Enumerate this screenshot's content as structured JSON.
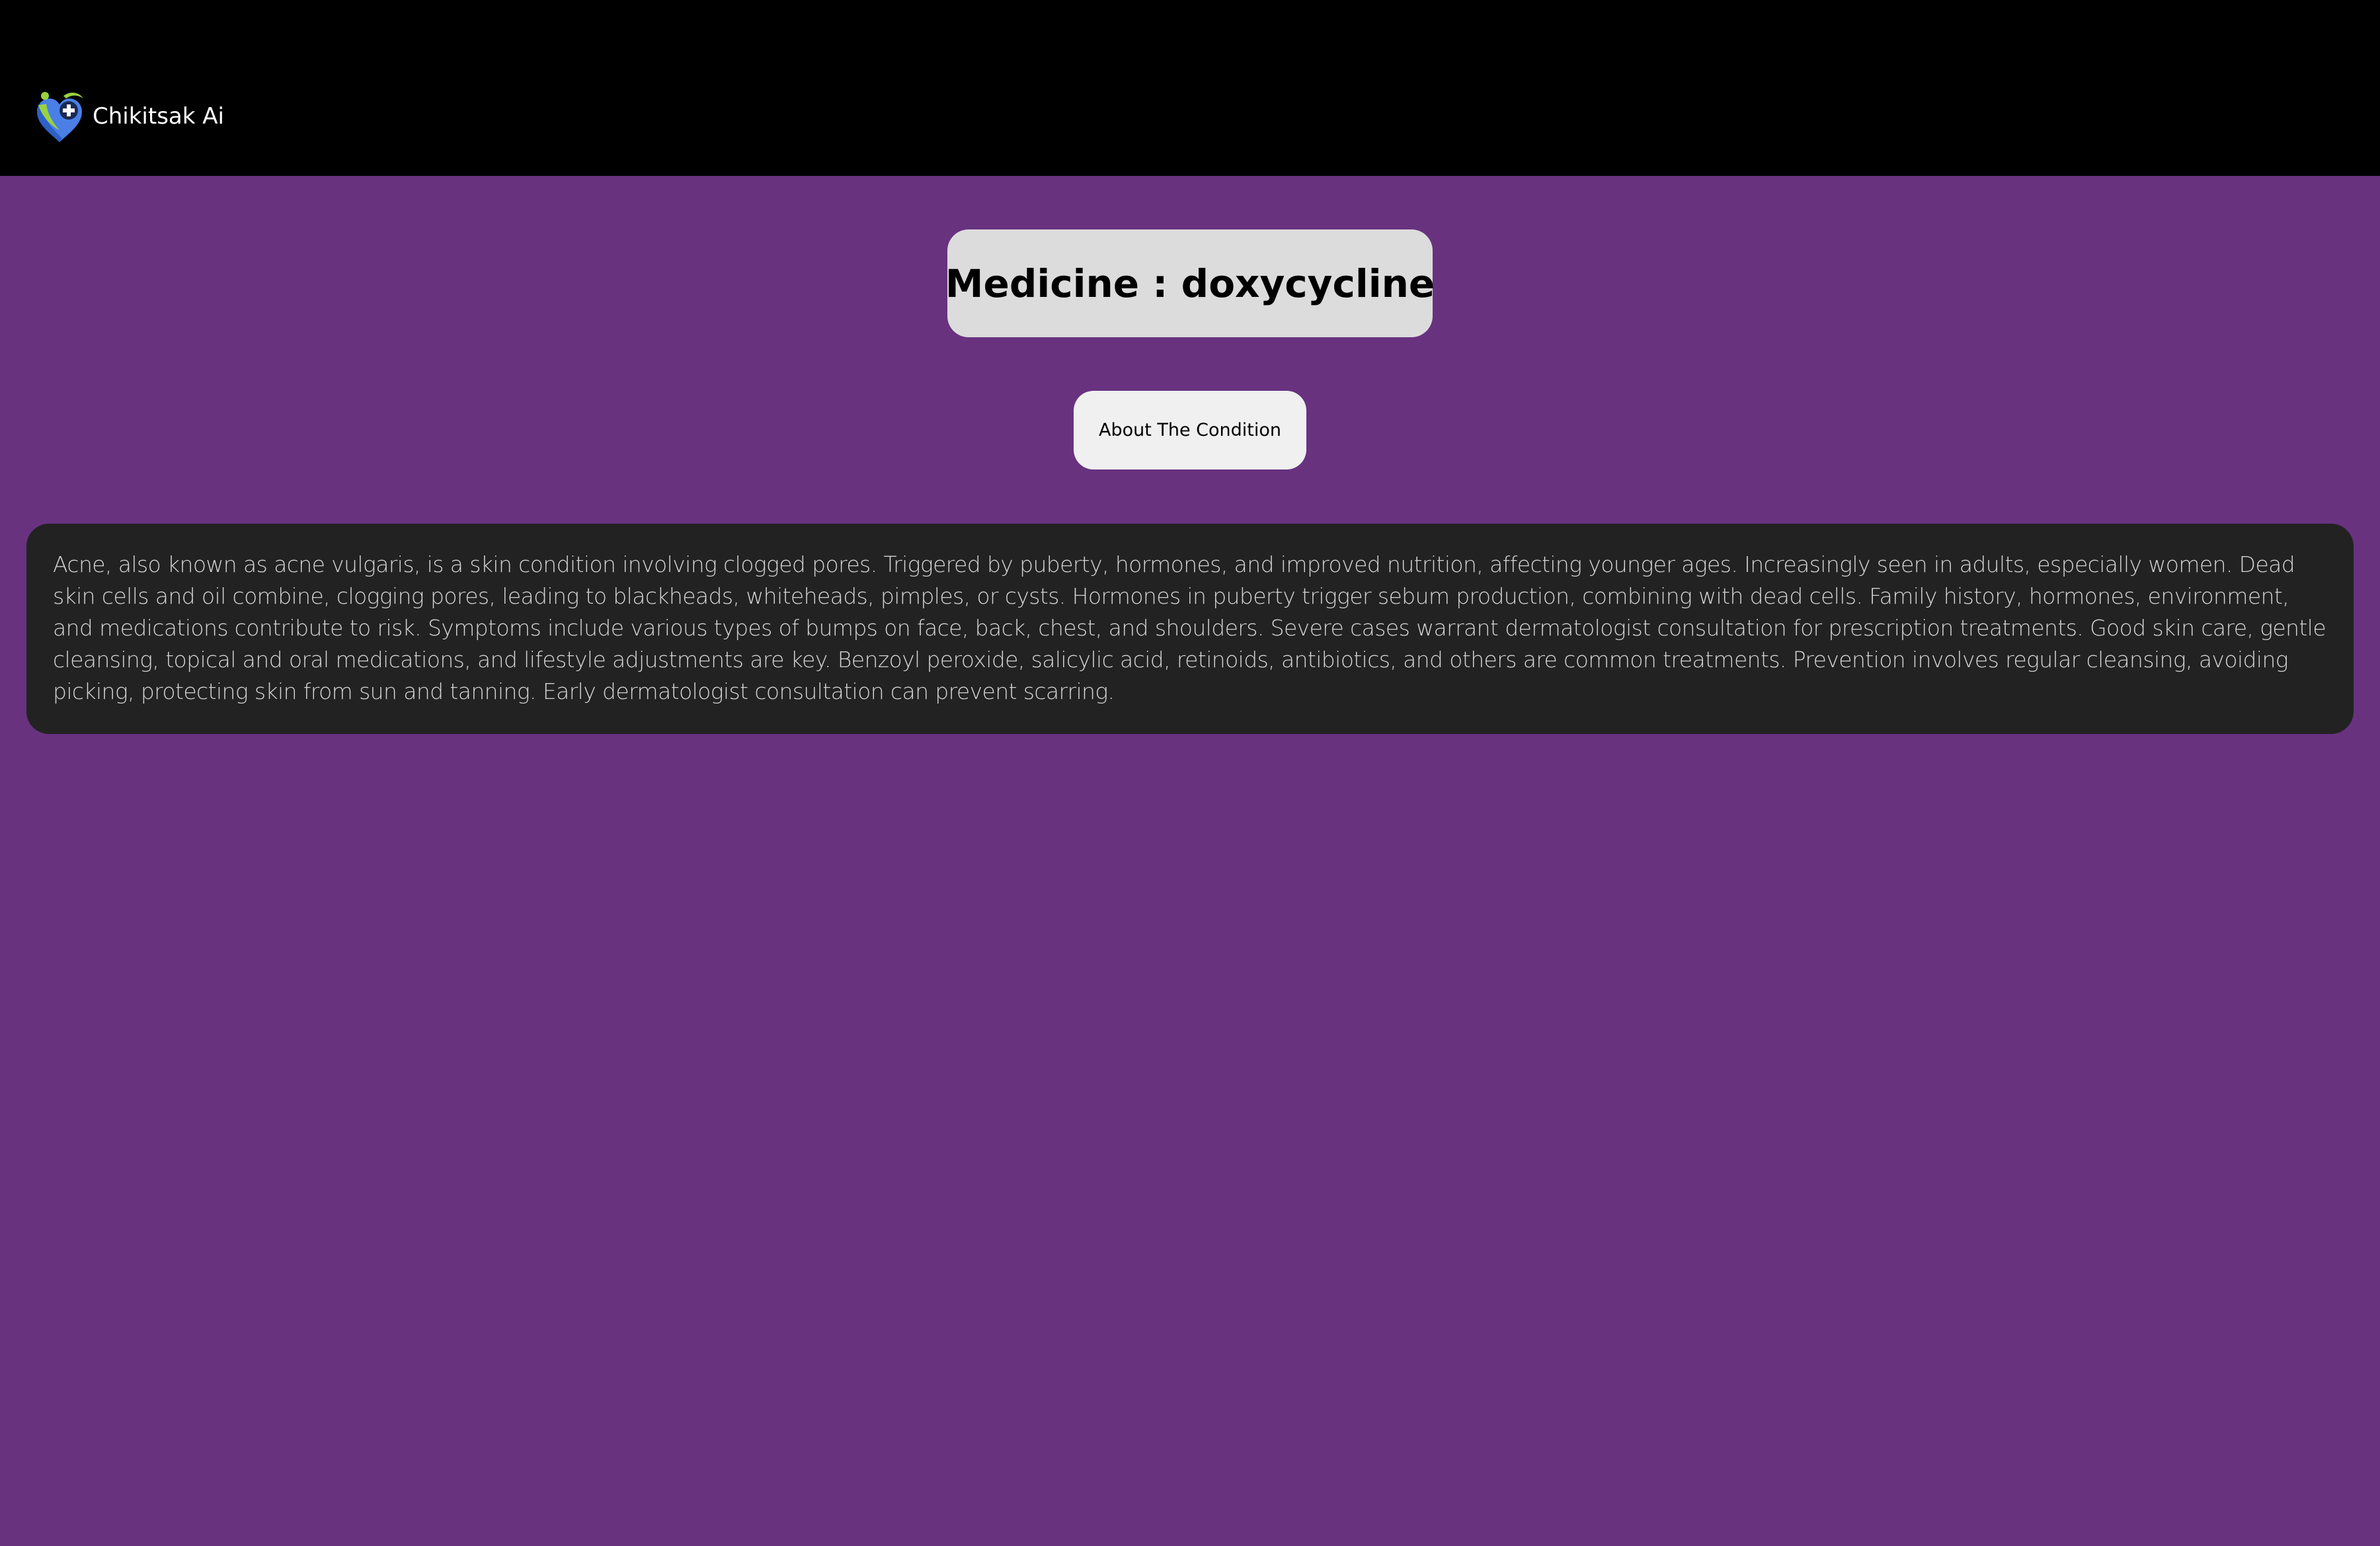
{
  "header": {
    "brand_name": "Chikitsak Ai",
    "logo_icon": "heart-pin-medical-cross-logo",
    "background": "#000000"
  },
  "main": {
    "background": "#68327f",
    "title": "Medicine : doxycycline",
    "about_button_label": "About The Condition",
    "description": "Acne, also known as acne vulgaris, is a skin condition involving clogged pores. Triggered by puberty, hormones, and improved nutrition, affecting younger ages. Increasingly seen in adults, especially women. Dead skin cells and oil combine, clogging pores, leading to blackheads, whiteheads, pimples, or cysts. Hormones in puberty trigger sebum production, combining with dead cells. Family history, hormones, environment, and medications contribute to risk. Symptoms include various types of bumps on face, back, chest, and shoulders. Severe cases warrant dermatologist consultation for prescription treatments. Good skin care, gentle cleansing, topical and oral medications, and lifestyle adjustments are key. Benzoyl peroxide, salicylic acid, retinoids, antibiotics, and others are common treatments. Prevention involves regular cleansing, avoiding picking, protecting skin from sun and tanning. Early dermatologist consultation can prevent scarring."
  },
  "colors": {
    "title_card": "#dcdcdc",
    "button": "#f0f0f0",
    "description_card": "#222222",
    "description_text": "#d4d4d4",
    "logo_blue": "#4a7fe6",
    "logo_green": "#9bd13f"
  }
}
